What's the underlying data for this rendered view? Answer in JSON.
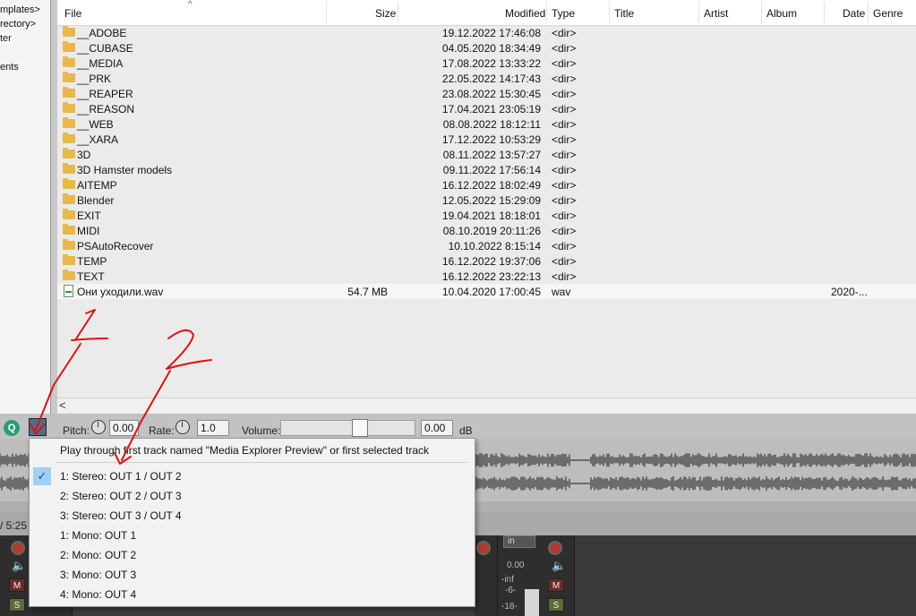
{
  "tree": {
    "items": [
      {
        "label": "mplates>",
        "selected": false
      },
      {
        "label": "rectory>",
        "selected": false
      },
      {
        "label": "ter",
        "selected": true
      },
      {
        "label": "ents",
        "selected": false
      }
    ]
  },
  "columns": [
    "File",
    "Size",
    "Modified",
    "Type",
    "Title",
    "Artist",
    "Album",
    "Date",
    "Genre"
  ],
  "rows": [
    {
      "name": "__ADOBE",
      "size": "",
      "modified": "19.12.2022 17:46:08",
      "type": "<dir>",
      "date": "",
      "kind": "folder"
    },
    {
      "name": "__CUBASE",
      "size": "",
      "modified": "04.05.2020 18:34:49",
      "type": "<dir>",
      "date": "",
      "kind": "folder"
    },
    {
      "name": "__MEDIA",
      "size": "",
      "modified": "17.08.2022 13:33:22",
      "type": "<dir>",
      "date": "",
      "kind": "folder"
    },
    {
      "name": "__PRK",
      "size": "",
      "modified": "22.05.2022 14:17:43",
      "type": "<dir>",
      "date": "",
      "kind": "folder"
    },
    {
      "name": "__REAPER",
      "size": "",
      "modified": "23.08.2022 15:30:45",
      "type": "<dir>",
      "date": "",
      "kind": "folder"
    },
    {
      "name": "__REASON",
      "size": "",
      "modified": "17.04.2021 23:05:19",
      "type": "<dir>",
      "date": "",
      "kind": "folder"
    },
    {
      "name": "__WEB",
      "size": "",
      "modified": "08.08.2022 18:12:11",
      "type": "<dir>",
      "date": "",
      "kind": "folder"
    },
    {
      "name": "__XARA",
      "size": "",
      "modified": "17.12.2022 10:53:29",
      "type": "<dir>",
      "date": "",
      "kind": "folder"
    },
    {
      "name": "3D",
      "size": "",
      "modified": "08.11.2022 13:57:27",
      "type": "<dir>",
      "date": "",
      "kind": "folder"
    },
    {
      "name": "3D Hamster models",
      "size": "",
      "modified": "09.11.2022 17:56:14",
      "type": "<dir>",
      "date": "",
      "kind": "folder"
    },
    {
      "name": "AITEMP",
      "size": "",
      "modified": "16.12.2022 18:02:49",
      "type": "<dir>",
      "date": "",
      "kind": "folder"
    },
    {
      "name": "Blender",
      "size": "",
      "modified": "12.05.2022 15:29:09",
      "type": "<dir>",
      "date": "",
      "kind": "folder"
    },
    {
      "name": "EXIT",
      "size": "",
      "modified": "19.04.2021 18:18:01",
      "type": "<dir>",
      "date": "",
      "kind": "folder"
    },
    {
      "name": "MIDI",
      "size": "",
      "modified": "08.10.2019 20:11:26",
      "type": "<dir>",
      "date": "",
      "kind": "folder"
    },
    {
      "name": "PSAutoRecover",
      "size": "",
      "modified": "10.10.2022 8:15:14",
      "type": "<dir>",
      "date": "",
      "kind": "folder"
    },
    {
      "name": "TEMP",
      "size": "",
      "modified": "16.12.2022 19:37:06",
      "type": "<dir>",
      "date": "",
      "kind": "folder"
    },
    {
      "name": "TEXT",
      "size": "",
      "modified": "16.12.2022 23:22:13",
      "type": "<dir>",
      "date": "",
      "kind": "folder"
    },
    {
      "name": "Они уходили.wav",
      "size": "54.7 MB",
      "modified": "10.04.2020 17:00:45",
      "type": "wav",
      "date": "2020-...",
      "kind": "wav"
    }
  ],
  "hscroll": {
    "left_arrow": "<"
  },
  "toolbar": {
    "search_icon": "Q",
    "pitch_label": "Pitch:",
    "pitch_value": "0.00",
    "rate_label": "Rate:",
    "rate_value": "1.0",
    "volume_label": "Volume:",
    "volume_value": "0.00",
    "volume_unit": "dB",
    "volume_level": 0.6
  },
  "time_readout": "/ 5:25",
  "popup": {
    "heading": "Play through first track named \"Media Explorer Preview\" or first selected track",
    "items": [
      {
        "label": "1: Stereo: OUT 1 / OUT 2",
        "checked": true
      },
      {
        "label": "2: Stereo: OUT 2 / OUT 3",
        "checked": false
      },
      {
        "label": "3: Stereo: OUT 3 / OUT 4",
        "checked": false
      },
      {
        "label": "1: Mono: OUT 1",
        "checked": false
      },
      {
        "label": "2: Mono: OUT 2",
        "checked": false
      },
      {
        "label": "3: Mono: OUT 3",
        "checked": false
      },
      {
        "label": "4: Mono: OUT 4",
        "checked": false
      }
    ]
  },
  "mixer": {
    "m_label": "M",
    "s_label": "S",
    "in_label": "in",
    "db_value": "0.00",
    "inf_label": "-inf",
    "scale_6": "-6-",
    "scale_18": "-18-"
  },
  "annotations": {
    "mark1": "1",
    "mark2": "2",
    "color": "#e01010"
  }
}
